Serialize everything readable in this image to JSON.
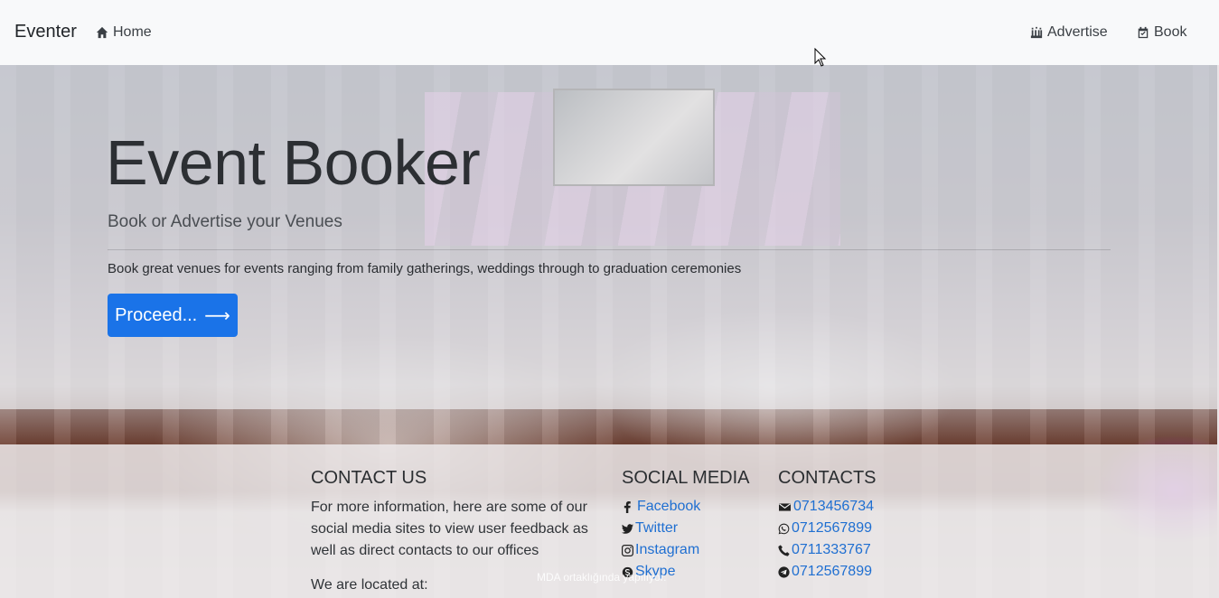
{
  "navbar": {
    "brand": "Eventer",
    "home": "Home",
    "advertise": "Advertise",
    "book": "Book"
  },
  "hero": {
    "title": "Event Booker",
    "lead": "Book or Advertise your Venues",
    "text": "Book great venues for events ranging from family gatherings, weddings through to graduation ceremonies",
    "button": "Proceed...",
    "button_arrow": "⟶"
  },
  "footer": {
    "contact_title": "CONTACT US",
    "contact_text": "For more information, here are some of our social media sites to view user feedback as well as direct contacts to our offices",
    "located": "We are located at:",
    "social_title": "SOCIAL MEDIA",
    "social": [
      {
        "label": "Facebook",
        "icon": "facebook-icon"
      },
      {
        "label": "Twitter",
        "icon": "twitter-icon"
      },
      {
        "label": "Instagram",
        "icon": "instagram-icon"
      },
      {
        "label": "Skype",
        "icon": "skype-icon"
      }
    ],
    "contacts_title": "CONTACTS",
    "contacts": [
      {
        "label": "0713456734",
        "icon": "envelope-icon"
      },
      {
        "label": "0712567899",
        "icon": "whatsapp-icon"
      },
      {
        "label": "0711333767",
        "icon": "phone-icon"
      },
      {
        "label": "0712567899",
        "icon": "telegram-icon"
      }
    ]
  },
  "overlay": "MDA ortaklığında yapılıyor.",
  "colors": {
    "accent": "#1a73e8",
    "link": "#1f6fd1",
    "navbar_bg": "#f8f9fa"
  }
}
